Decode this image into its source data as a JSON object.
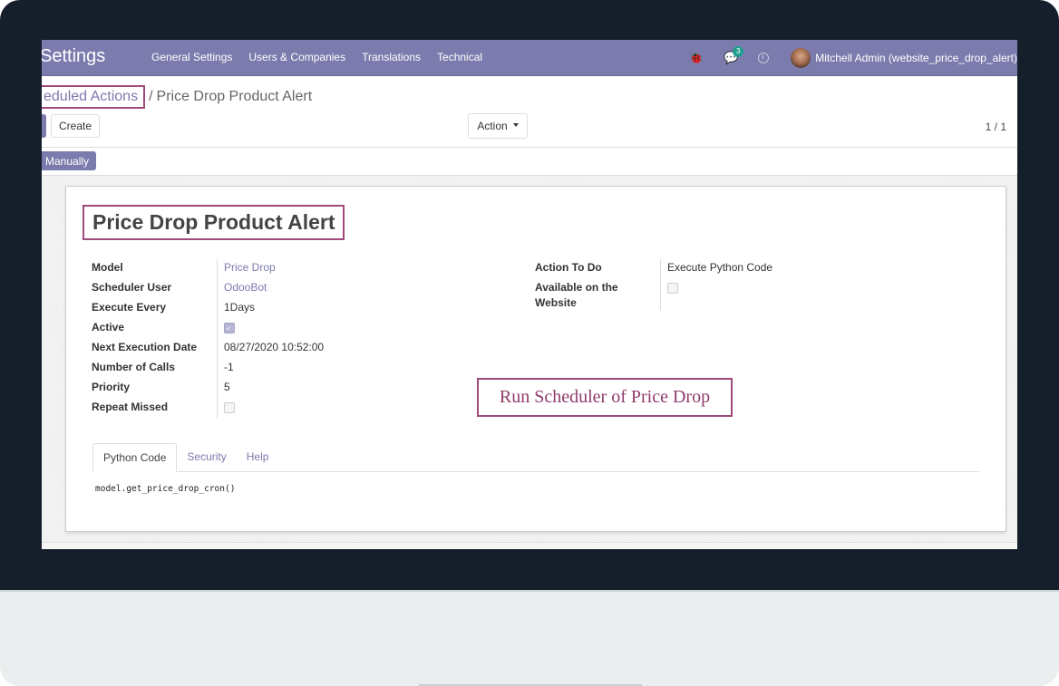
{
  "navbar": {
    "app_title": "Settings",
    "menu": [
      "General Settings",
      "Users & Companies",
      "Translations",
      "Technical"
    ],
    "message_count": "3",
    "user_name": "Mitchell Admin (website_price_drop_alert)"
  },
  "breadcrumb": {
    "parent": "Scheduled Actions",
    "parent_visible": "eduled Actions",
    "separator": "/",
    "current": "Price Drop Product Alert"
  },
  "control_panel": {
    "create_label": "Create",
    "action_label": "Action",
    "pager": "1 / 1"
  },
  "statusbar": {
    "run_manually_label": "Manually"
  },
  "record": {
    "title": "Price Drop Product Alert",
    "left_fields": [
      {
        "label": "Model",
        "value": "Price Drop"
      },
      {
        "label": "Scheduler User",
        "value": "OdooBot"
      },
      {
        "label": "Execute Every",
        "value": "1Days"
      },
      {
        "label": "Active",
        "value": true
      },
      {
        "label": "Next Execution Date",
        "value": "08/27/2020 10:52:00"
      },
      {
        "label": "Number of Calls",
        "value": "-1"
      },
      {
        "label": "Priority",
        "value": "5"
      },
      {
        "label": "Repeat Missed",
        "value": false
      }
    ],
    "right_fields": [
      {
        "label": "Action To Do",
        "value": "Execute Python Code"
      },
      {
        "label": "Available on the Website",
        "value": false
      }
    ]
  },
  "annotation": "Run Scheduler of Price Drop",
  "tabs": [
    {
      "label": "Python Code",
      "active": true
    },
    {
      "label": "Security",
      "active": false
    },
    {
      "label": "Help",
      "active": false
    }
  ],
  "python_code": "model.get_price_drop_cron()",
  "colors": {
    "brand": "#7c7bad",
    "annotation": "#a04a7a",
    "badge": "#1f9e8e",
    "bezel": "#151f2b"
  }
}
